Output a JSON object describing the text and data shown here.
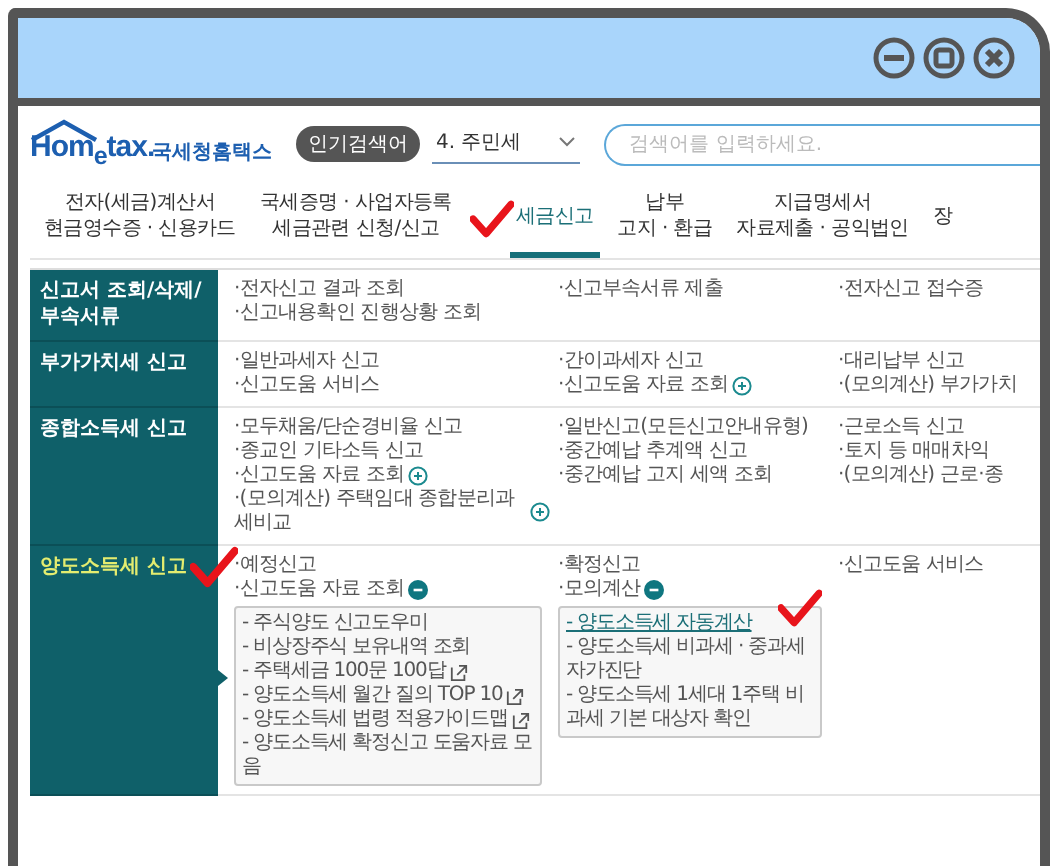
{
  "header": {
    "logo": "Hom$_{e}$tax.",
    "logo_subtitle": "국세청홈택스",
    "popular_badge": "인기검색어",
    "popular_dropdown": {
      "value": "4. 주민세"
    },
    "search": {
      "placeholder": "검색어를 입력하세요."
    }
  },
  "nav_tabs": [
    {
      "lines": [
        "전자(세금)계산서",
        "현금영수증 · 신용카드"
      ],
      "selected": false
    },
    {
      "lines": [
        "국세증명 · 사업자등록",
        "세금관련 신청/신고"
      ],
      "selected": false
    },
    {
      "lines": [
        "세금신고"
      ],
      "selected": true,
      "marked": true
    },
    {
      "lines": [
        "납부",
        "고지 · 환급"
      ],
      "selected": false
    },
    {
      "lines": [
        "지급명세서",
        "자료제출 · 공익법인"
      ],
      "selected": false
    },
    {
      "lines": [
        "장"
      ],
      "selected": false
    }
  ],
  "menu_rows": [
    {
      "heading_lines": [
        "신고서 조회/삭제/",
        "부속서류"
      ],
      "selected": false,
      "columns": [
        [
          {
            "text": "·전자신고 결과 조회"
          },
          {
            "text": "·신고내용확인 진행상황 조회"
          }
        ],
        [
          {
            "text": "·신고부속서류 제출"
          }
        ],
        [
          {
            "text": "·전자신고 접수증"
          }
        ]
      ]
    },
    {
      "heading_lines": [
        "부가가치세 신고"
      ],
      "selected": false,
      "columns": [
        [
          {
            "text": "·일반과세자 신고"
          },
          {
            "text": "·신고도움 서비스"
          }
        ],
        [
          {
            "text": "·간이과세자 신고"
          },
          {
            "text": "·신고도움 자료 조회",
            "expanded": false
          }
        ],
        [
          {
            "text": "·대리납부 신고"
          },
          {
            "text": "·(모의계산) 부가가치"
          }
        ]
      ]
    },
    {
      "heading_lines": [
        "종합소득세 신고"
      ],
      "selected": false,
      "columns": [
        [
          {
            "text": "·모두채움/단순경비율 신고"
          },
          {
            "text": "·종교인 기타소득 신고"
          },
          {
            "text": "·신고도움 자료 조회",
            "expanded": false
          },
          {
            "text": "·(모의계산) 주택임대 종합분리과세비교",
            "expanded": false
          }
        ],
        [
          {
            "text": "·일반신고(모든신고안내유형)"
          },
          {
            "text": "·중간예납 추계액 신고"
          },
          {
            "text": "·중간예납 고지 세액 조회"
          }
        ],
        [
          {
            "text": "·근로소득 신고"
          },
          {
            "text": "·토지 등 매매차익"
          },
          {
            "text": "·(모의계산) 근로·종"
          }
        ]
      ]
    },
    {
      "heading_lines": [
        "양도소득세 신고"
      ],
      "selected": true,
      "marked": true,
      "columns": [
        [
          {
            "text": "·예정신고"
          },
          {
            "text": "·신고도움 자료 조회",
            "expanded": true,
            "submenu": [
              {
                "text": "- 주식양도 신고도우미",
                "kind": "text"
              },
              {
                "text": "- 비상장주식 보유내역 조회",
                "kind": "text"
              },
              {
                "text": "- 주택세금 100문 100답",
                "kind": "text",
                "external": true
              },
              {
                "text": "- 양도소득세 월간 질의 TOP 10",
                "kind": "text",
                "external": true
              },
              {
                "text": "- 양도소득세 법령 적용가이드맵",
                "kind": "text",
                "external": true
              },
              {
                "text": "- 양도소득세 확정신고 도움자료 모음",
                "kind": "text"
              }
            ]
          }
        ],
        [
          {
            "text": "·확정신고"
          },
          {
            "text": "·모의계산",
            "expanded": true,
            "submenu": [
              {
                "text": "- 양도소득세 자동계산",
                "kind": "link",
                "marked": true
              },
              {
                "text": "- 양도소득세 비과세 · 중과세 자가진단",
                "kind": "text"
              },
              {
                "text": "- 양도소득세 1세대 1주택 비과세 기본 대상자 확인",
                "kind": "text"
              }
            ]
          }
        ],
        [
          {
            "text": "·신고도움 서비스"
          }
        ]
      ]
    }
  ]
}
